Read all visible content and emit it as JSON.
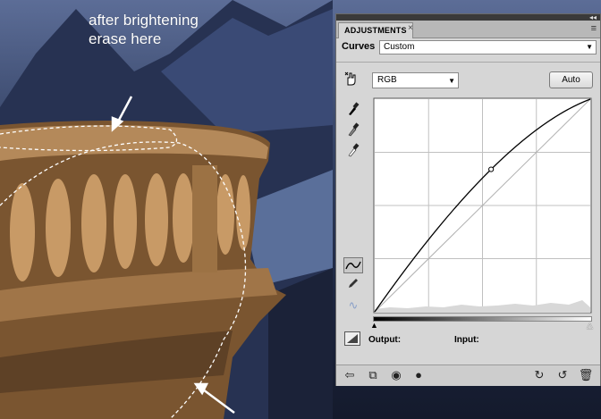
{
  "annotation": {
    "line1": "after brightening",
    "line2": "erase here"
  },
  "panel": {
    "tab_title": "ADJUSTMENTS",
    "tab_close": "×",
    "collapse_glyph": "◂◂",
    "menu_glyph": "≡",
    "adjustment_type": "Curves",
    "preset_value": "Custom",
    "channel_value": "RGB",
    "auto_label": "Auto",
    "output_label": "Output:",
    "input_label": "Input:",
    "dropdown_glyph": "▼"
  },
  "curve": {
    "points": [
      [
        0,
        0
      ],
      [
        0.54,
        0.67
      ],
      [
        1,
        1
      ]
    ],
    "baseline_visible": true,
    "grid_divisions": 4
  },
  "icons": {
    "hand": "targeted-adjustment-icon",
    "eyedroppers": [
      "black-eyedropper-icon",
      "gray-eyedropper-icon",
      "white-eyedropper-icon"
    ],
    "edit_modes": [
      "curve-points-icon",
      "pencil-icon",
      "smooth-icon"
    ],
    "bottom": [
      "back-icon",
      "clip-to-layer-icon",
      "visibility-eye-icon",
      "view-previous-icon",
      "reset-icon",
      "trash-icon"
    ]
  },
  "colors": {
    "panel_bg": "#d6d6d6",
    "annotation_text": "#ffffff"
  }
}
